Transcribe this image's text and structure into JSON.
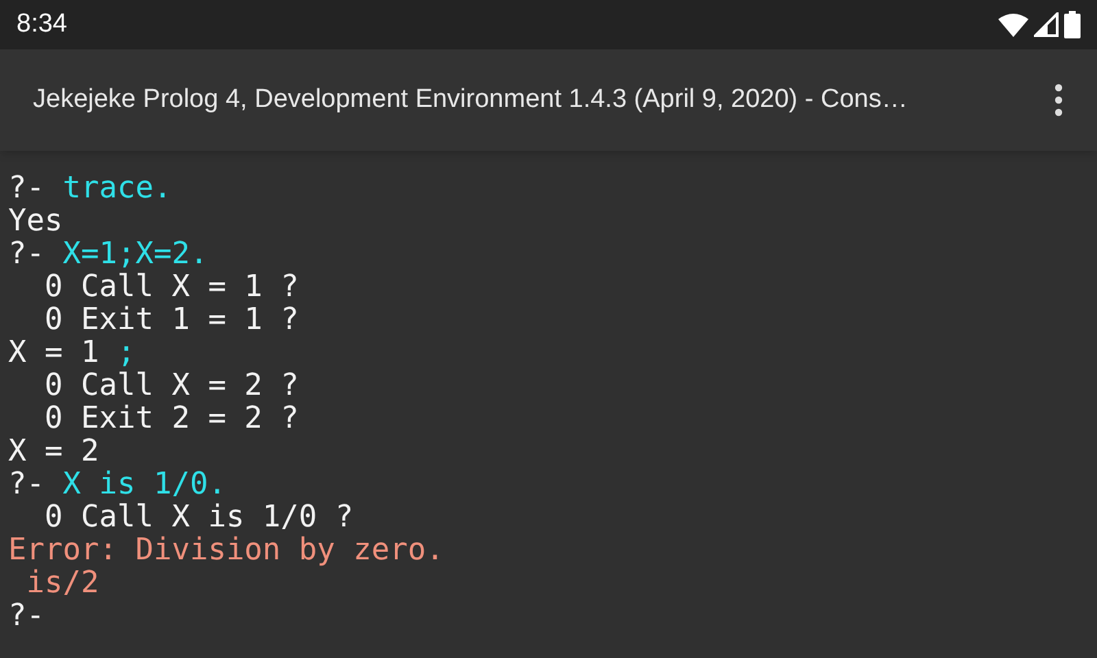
{
  "status_bar": {
    "time": "8:34"
  },
  "app_bar": {
    "title": "Jekejeke Prolog 4, Development Environment 1.4.3 (April 9, 2020) - Cons…"
  },
  "console": {
    "lines": [
      [
        {
          "kind": "output",
          "text": "?- "
        },
        {
          "kind": "input",
          "text": "trace."
        }
      ],
      [
        {
          "kind": "output",
          "text": "Yes"
        }
      ],
      [
        {
          "kind": "output",
          "text": "?- "
        },
        {
          "kind": "input",
          "text": "X=1;X=2."
        }
      ],
      [
        {
          "kind": "output",
          "text": "  0 Call X = 1 ?"
        }
      ],
      [
        {
          "kind": "output",
          "text": "  0 Exit 1 = 1 ?"
        }
      ],
      [
        {
          "kind": "output",
          "text": "X = 1 "
        },
        {
          "kind": "input",
          "text": ";"
        }
      ],
      [
        {
          "kind": "output",
          "text": "  0 Call X = 2 ?"
        }
      ],
      [
        {
          "kind": "output",
          "text": "  0 Exit 2 = 2 ?"
        }
      ],
      [
        {
          "kind": "output",
          "text": "X = 2"
        }
      ],
      [
        {
          "kind": "output",
          "text": "?- "
        },
        {
          "kind": "input",
          "text": "X is 1/0."
        }
      ],
      [
        {
          "kind": "output",
          "text": "  0 Call X is 1/0 ?"
        }
      ],
      [
        {
          "kind": "error",
          "text": "Error: Division by zero."
        }
      ],
      [
        {
          "kind": "error",
          "text": " is/2"
        }
      ],
      [
        {
          "kind": "output",
          "text": "?-"
        }
      ]
    ]
  }
}
